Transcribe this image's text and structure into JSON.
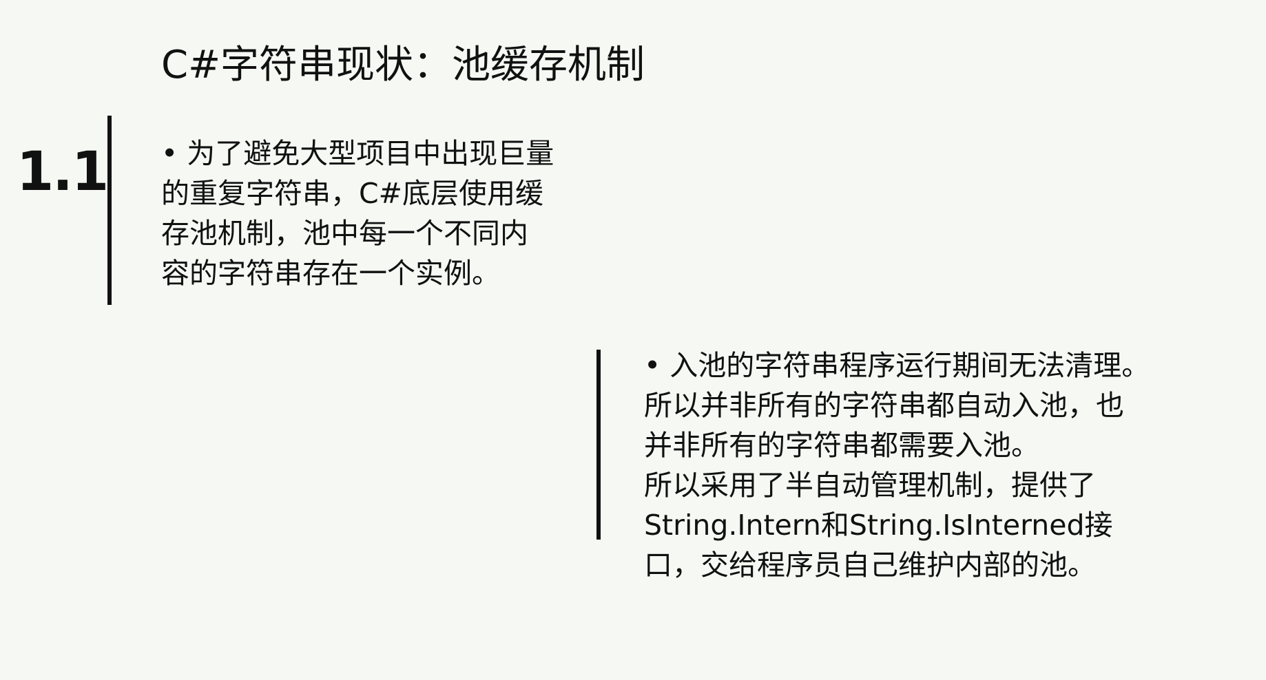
{
  "slide": {
    "title": "C#字符串现状：池缓存机制",
    "section_number": "1.1",
    "block1": {
      "lines": [
        "• 为了避免大型项目中出现巨量",
        "的重复字符串，C#底层使用缓",
        "存池机制，池中每一个不同内",
        "容的字符串存在一个实例。"
      ]
    },
    "block2": {
      "lines": [
        "• 入池的字符串程序运行期间无法清理。",
        "所以并非所有的字符串都自动入池，也",
        "并非所有的字符串都需要入池。",
        "所以采用了半自动管理机制，提供了",
        "String.Intern和String.IsInterned接",
        "口，交给程序员自己维护内部的池。"
      ]
    }
  }
}
